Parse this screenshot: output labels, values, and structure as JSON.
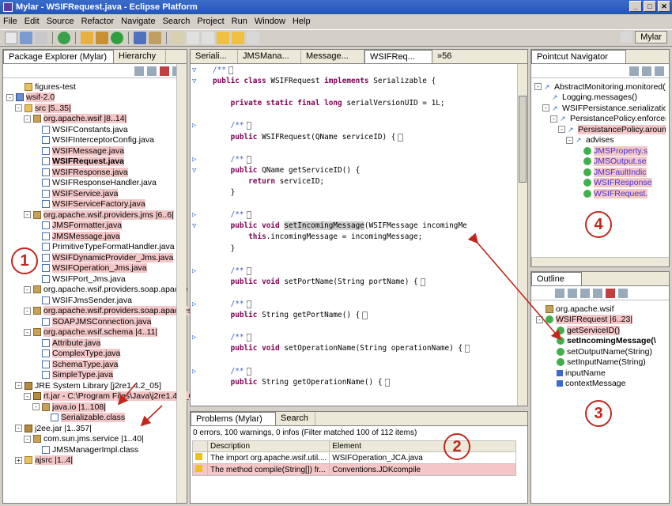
{
  "window": {
    "title": "Mylar - WSIFRequest.java - Eclipse Platform",
    "controls": [
      "_",
      "□",
      "✕"
    ]
  },
  "menu": [
    "File",
    "Edit",
    "Source",
    "Refactor",
    "Navigate",
    "Search",
    "Project",
    "Run",
    "Window",
    "Help"
  ],
  "perspective": {
    "label": "Mylar"
  },
  "package_explorer": {
    "tabs": [
      "Package Explorer (Mylar)",
      "Hierarchy"
    ],
    "rows": [
      {
        "indent": 1,
        "icon": "folder",
        "text": "figures-test",
        "exp": "",
        "hl": false
      },
      {
        "indent": 0,
        "icon": "proj",
        "text": "wsif-2.0",
        "exp": "-",
        "hl": true
      },
      {
        "indent": 1,
        "icon": "folder",
        "text": "src  |5..35|",
        "exp": "-",
        "hl": true
      },
      {
        "indent": 2,
        "icon": "pkg",
        "text": "org.apache.wsif  |8..14|",
        "exp": "-",
        "hl": true
      },
      {
        "indent": 3,
        "icon": "java",
        "text": "WSIFConstants.java",
        "exp": "",
        "hl": false
      },
      {
        "indent": 3,
        "icon": "java",
        "text": "WSIFInterceptorConfig.java",
        "exp": "",
        "hl": false
      },
      {
        "indent": 3,
        "icon": "java",
        "text": "WSIFMessage.java",
        "exp": "",
        "hl": true
      },
      {
        "indent": 3,
        "icon": "java",
        "text": "WSIFRequest.java",
        "exp": "",
        "hl": true,
        "bold": true
      },
      {
        "indent": 3,
        "icon": "java",
        "text": "WSIFResponse.java",
        "exp": "",
        "hl": true
      },
      {
        "indent": 3,
        "icon": "java",
        "text": "WSIFResponseHandler.java",
        "exp": "",
        "hl": false
      },
      {
        "indent": 3,
        "icon": "java",
        "text": "WSIFService.java",
        "exp": "",
        "hl": true
      },
      {
        "indent": 3,
        "icon": "java",
        "text": "WSIFServiceFactory.java",
        "exp": "",
        "hl": true
      },
      {
        "indent": 2,
        "icon": "pkg",
        "text": "org.apache.wsif.providers.jms  |6..6|",
        "exp": "-",
        "hl": true
      },
      {
        "indent": 3,
        "icon": "java",
        "text": "JMSFormatter.java",
        "exp": "",
        "hl": true
      },
      {
        "indent": 3,
        "icon": "java",
        "text": "JMSMessage.java",
        "exp": "",
        "hl": true
      },
      {
        "indent": 3,
        "icon": "java",
        "text": "PrimitiveTypeFormatHandler.java",
        "exp": "",
        "hl": false
      },
      {
        "indent": 3,
        "icon": "java",
        "text": "WSIFDynamicProvider_Jms.java",
        "exp": "",
        "hl": true
      },
      {
        "indent": 3,
        "icon": "java",
        "text": "WSIFOperation_Jms.java",
        "exp": "",
        "hl": true
      },
      {
        "indent": 3,
        "icon": "java",
        "text": "WSIFPort_Jms.java",
        "exp": "",
        "hl": false
      },
      {
        "indent": 2,
        "icon": "pkg",
        "text": "org.apache.wsif.providers.soap.apache",
        "exp": "-",
        "hl": false
      },
      {
        "indent": 3,
        "icon": "java",
        "text": "WSIFJmsSender.java",
        "exp": "",
        "hl": false
      },
      {
        "indent": 2,
        "icon": "pkg",
        "text": "org.apache.wsif.providers.soap.apaches",
        "exp": "-",
        "hl": true
      },
      {
        "indent": 3,
        "icon": "java",
        "text": "SOAPJMSConnection.java",
        "exp": "",
        "hl": true
      },
      {
        "indent": 2,
        "icon": "pkg",
        "text": "org.apache.wsif.schema  |4..11|",
        "exp": "-",
        "hl": true
      },
      {
        "indent": 3,
        "icon": "java",
        "text": "Attribute.java",
        "exp": "",
        "hl": true
      },
      {
        "indent": 3,
        "icon": "java",
        "text": "ComplexType.java",
        "exp": "",
        "hl": true
      },
      {
        "indent": 3,
        "icon": "java",
        "text": "SchemaType.java",
        "exp": "",
        "hl": true
      },
      {
        "indent": 3,
        "icon": "java",
        "text": "SimpleType.java",
        "exp": "",
        "hl": true
      },
      {
        "indent": 1,
        "icon": "jar",
        "text": "JRE System Library [j2re1.4.2_05]",
        "exp": "-",
        "hl": false
      },
      {
        "indent": 2,
        "icon": "jar",
        "text": "rt.jar - C:\\Program Files\\Java\\j2re1.4.2_0",
        "exp": "-",
        "hl": true
      },
      {
        "indent": 3,
        "icon": "pkg",
        "text": "java.io  |1..108|",
        "exp": "-",
        "hl": true
      },
      {
        "indent": 4,
        "icon": "java",
        "text": "Serializable.class",
        "exp": "",
        "hl": true
      },
      {
        "indent": 1,
        "icon": "jar",
        "text": "j2ee.jar  |1..357|",
        "exp": "-",
        "hl": false
      },
      {
        "indent": 2,
        "icon": "pkg",
        "text": "com.sun.jms.service  |1..40|",
        "exp": "-",
        "hl": false
      },
      {
        "indent": 3,
        "icon": "java",
        "text": "JMSManagerImpl.class",
        "exp": "",
        "hl": false
      },
      {
        "indent": 1,
        "icon": "folder",
        "text": "ajsrc  |1..4|",
        "exp": "+",
        "hl": true
      }
    ]
  },
  "editor": {
    "tabs": [
      "Seriali...",
      "JMSMana...",
      "Message...",
      "WSIFReq...",
      "»56"
    ],
    "lines": [
      {
        "gut": "▽",
        "t": [
          [
            "c",
            "/**"
          ],
          [
            "b",
            "□"
          ]
        ]
      },
      {
        "gut": "▽",
        "t": [
          [
            "k",
            "public class "
          ],
          [
            "p",
            "WSIFRequest "
          ],
          [
            "k",
            "implements "
          ],
          [
            "p",
            "Serializable {"
          ]
        ]
      },
      {
        "gut": "",
        "t": [
          [
            "p",
            ""
          ]
        ]
      },
      {
        "gut": "",
        "t": [
          [
            "p",
            "    "
          ],
          [
            "k",
            "private static final long "
          ],
          [
            "p",
            "serialVersionUID = 1L;"
          ]
        ]
      },
      {
        "gut": "",
        "t": [
          [
            "p",
            ""
          ]
        ]
      },
      {
        "gut": "▷",
        "t": [
          [
            "p",
            "    "
          ],
          [
            "c",
            "/**"
          ],
          [
            "b",
            "□"
          ]
        ]
      },
      {
        "gut": "",
        "t": [
          [
            "p",
            "    "
          ],
          [
            "k",
            "public "
          ],
          [
            "p",
            "WSIFRequest(QName serviceID) {"
          ],
          [
            "b",
            "□"
          ]
        ]
      },
      {
        "gut": "",
        "t": [
          [
            "p",
            ""
          ]
        ]
      },
      {
        "gut": "▷",
        "t": [
          [
            "p",
            "    "
          ],
          [
            "c",
            "/**"
          ],
          [
            "b",
            "□"
          ]
        ]
      },
      {
        "gut": "▽",
        "t": [
          [
            "p",
            "    "
          ],
          [
            "k",
            "public "
          ],
          [
            "p",
            "QName getServiceID() {"
          ]
        ]
      },
      {
        "gut": "",
        "t": [
          [
            "p",
            "        "
          ],
          [
            "k",
            "return "
          ],
          [
            "p",
            "serviceID;"
          ]
        ]
      },
      {
        "gut": "",
        "t": [
          [
            "p",
            "    }"
          ]
        ]
      },
      {
        "gut": "",
        "t": [
          [
            "p",
            ""
          ]
        ]
      },
      {
        "gut": "▷",
        "t": [
          [
            "p",
            "    "
          ],
          [
            "c",
            "/**"
          ],
          [
            "b",
            "□"
          ]
        ]
      },
      {
        "gut": "▽",
        "t": [
          [
            "p",
            "    "
          ],
          [
            "k",
            "public void "
          ],
          [
            "s",
            "setIncomingMessage"
          ],
          [
            "p",
            "(WSIFMessage incomingMe"
          ]
        ]
      },
      {
        "gut": "",
        "t": [
          [
            "p",
            "        "
          ],
          [
            "k",
            "this"
          ],
          [
            "p",
            ".incomingMessage = incomingMessage;"
          ]
        ]
      },
      {
        "gut": "",
        "t": [
          [
            "p",
            "    }"
          ]
        ]
      },
      {
        "gut": "",
        "t": [
          [
            "p",
            ""
          ]
        ]
      },
      {
        "gut": "▷",
        "t": [
          [
            "p",
            "    "
          ],
          [
            "c",
            "/**"
          ],
          [
            "b",
            "□"
          ]
        ]
      },
      {
        "gut": "",
        "t": [
          [
            "p",
            "    "
          ],
          [
            "k",
            "public void "
          ],
          [
            "p",
            "setPortName(String portName) {"
          ],
          [
            "b",
            "□"
          ]
        ]
      },
      {
        "gut": "",
        "t": [
          [
            "p",
            ""
          ]
        ]
      },
      {
        "gut": "▷",
        "t": [
          [
            "p",
            "    "
          ],
          [
            "c",
            "/**"
          ],
          [
            "b",
            "□"
          ]
        ]
      },
      {
        "gut": "",
        "t": [
          [
            "p",
            "    "
          ],
          [
            "k",
            "public "
          ],
          [
            "p",
            "String getPortName() {"
          ],
          [
            "b",
            "□"
          ]
        ]
      },
      {
        "gut": "",
        "t": [
          [
            "p",
            ""
          ]
        ]
      },
      {
        "gut": "▷",
        "t": [
          [
            "p",
            "    "
          ],
          [
            "c",
            "/**"
          ],
          [
            "b",
            "□"
          ]
        ]
      },
      {
        "gut": "",
        "t": [
          [
            "p",
            "    "
          ],
          [
            "k",
            "public void "
          ],
          [
            "p",
            "setOperationName(String operationName) {"
          ],
          [
            "b",
            "□"
          ]
        ]
      },
      {
        "gut": "",
        "t": [
          [
            "p",
            ""
          ]
        ]
      },
      {
        "gut": "▷",
        "t": [
          [
            "p",
            "    "
          ],
          [
            "c",
            "/**"
          ],
          [
            "b",
            "□"
          ]
        ]
      },
      {
        "gut": "",
        "t": [
          [
            "p",
            "    "
          ],
          [
            "k",
            "public "
          ],
          [
            "p",
            "String getOperationName() {"
          ],
          [
            "b",
            "□"
          ]
        ]
      }
    ]
  },
  "problems": {
    "tabs": [
      "Problems (Mylar)",
      "Search"
    ],
    "summary": "0 errors, 100 warnings, 0 infos (Filter matched 100 of 112 items)",
    "headers": [
      "Description",
      "Element"
    ],
    "rows": [
      {
        "desc": "The import org.apache.wsif.util....",
        "elem": "WSIFOperation_JCA.java",
        "hl": false
      },
      {
        "desc": "The method compile(String[]) fr...",
        "elem": "Conventions.JDKcompile",
        "hl": true
      }
    ]
  },
  "pointcut": {
    "tab": "Pointcut Navigator",
    "rows": [
      {
        "indent": 0,
        "icon": "arr",
        "text": "AbstractMonitoring.monitored()",
        "hl": false,
        "exp": "-"
      },
      {
        "indent": 1,
        "icon": "arr",
        "text": "Logging.messages()",
        "hl": false,
        "exp": ""
      },
      {
        "indent": 1,
        "icon": "arr",
        "text": "WSIFPersistance.serialization(S",
        "hl": false,
        "exp": "-"
      },
      {
        "indent": 2,
        "icon": "arr",
        "text": "PersistancePolicy.enforcem",
        "hl": false,
        "exp": "-"
      },
      {
        "indent": 3,
        "icon": "arr",
        "text": "PersistancePolicy.aroun",
        "hl": true,
        "exp": "-"
      },
      {
        "indent": 4,
        "icon": "arr",
        "text": "advises",
        "hl": false,
        "exp": "-"
      },
      {
        "indent": 5,
        "icon": "grn",
        "text": "JMSProperty.s",
        "hl": true,
        "exp": ""
      },
      {
        "indent": 5,
        "icon": "grn",
        "text": "JMSOutput.se",
        "hl": true,
        "exp": ""
      },
      {
        "indent": 5,
        "icon": "grn",
        "text": "JMSFaultIndic",
        "hl": true,
        "exp": ""
      },
      {
        "indent": 5,
        "icon": "grn",
        "text": "WSIFResponse",
        "hl": true,
        "exp": ""
      },
      {
        "indent": 5,
        "icon": "grn",
        "text": "WSIFRequest.",
        "hl": true,
        "exp": ""
      }
    ]
  },
  "outline": {
    "tab": "Outline",
    "rows": [
      {
        "indent": 0,
        "icon": "pkg",
        "text": "org.apache.wsif",
        "hl": false,
        "bold": false
      },
      {
        "indent": 0,
        "icon": "grn",
        "text": "WSIFRequest  |6..23|",
        "hl": true,
        "bold": false,
        "exp": "-"
      },
      {
        "indent": 1,
        "icon": "grn",
        "text": "getServiceID()",
        "hl": true,
        "bold": false
      },
      {
        "indent": 1,
        "icon": "grn",
        "text": "setIncomingMessage(\\",
        "hl": false,
        "bold": true
      },
      {
        "indent": 1,
        "icon": "grn",
        "text": "setOutputName(String)",
        "hl": false,
        "bold": false
      },
      {
        "indent": 1,
        "icon": "grn",
        "text": "setInputName(String)",
        "hl": false,
        "bold": false
      },
      {
        "indent": 1,
        "icon": "blu",
        "text": "inputName",
        "hl": false,
        "bold": false
      },
      {
        "indent": 1,
        "icon": "blu",
        "text": "contextMessage",
        "hl": false,
        "bold": false
      }
    ]
  },
  "callouts": [
    "1",
    "2",
    "3",
    "4"
  ]
}
